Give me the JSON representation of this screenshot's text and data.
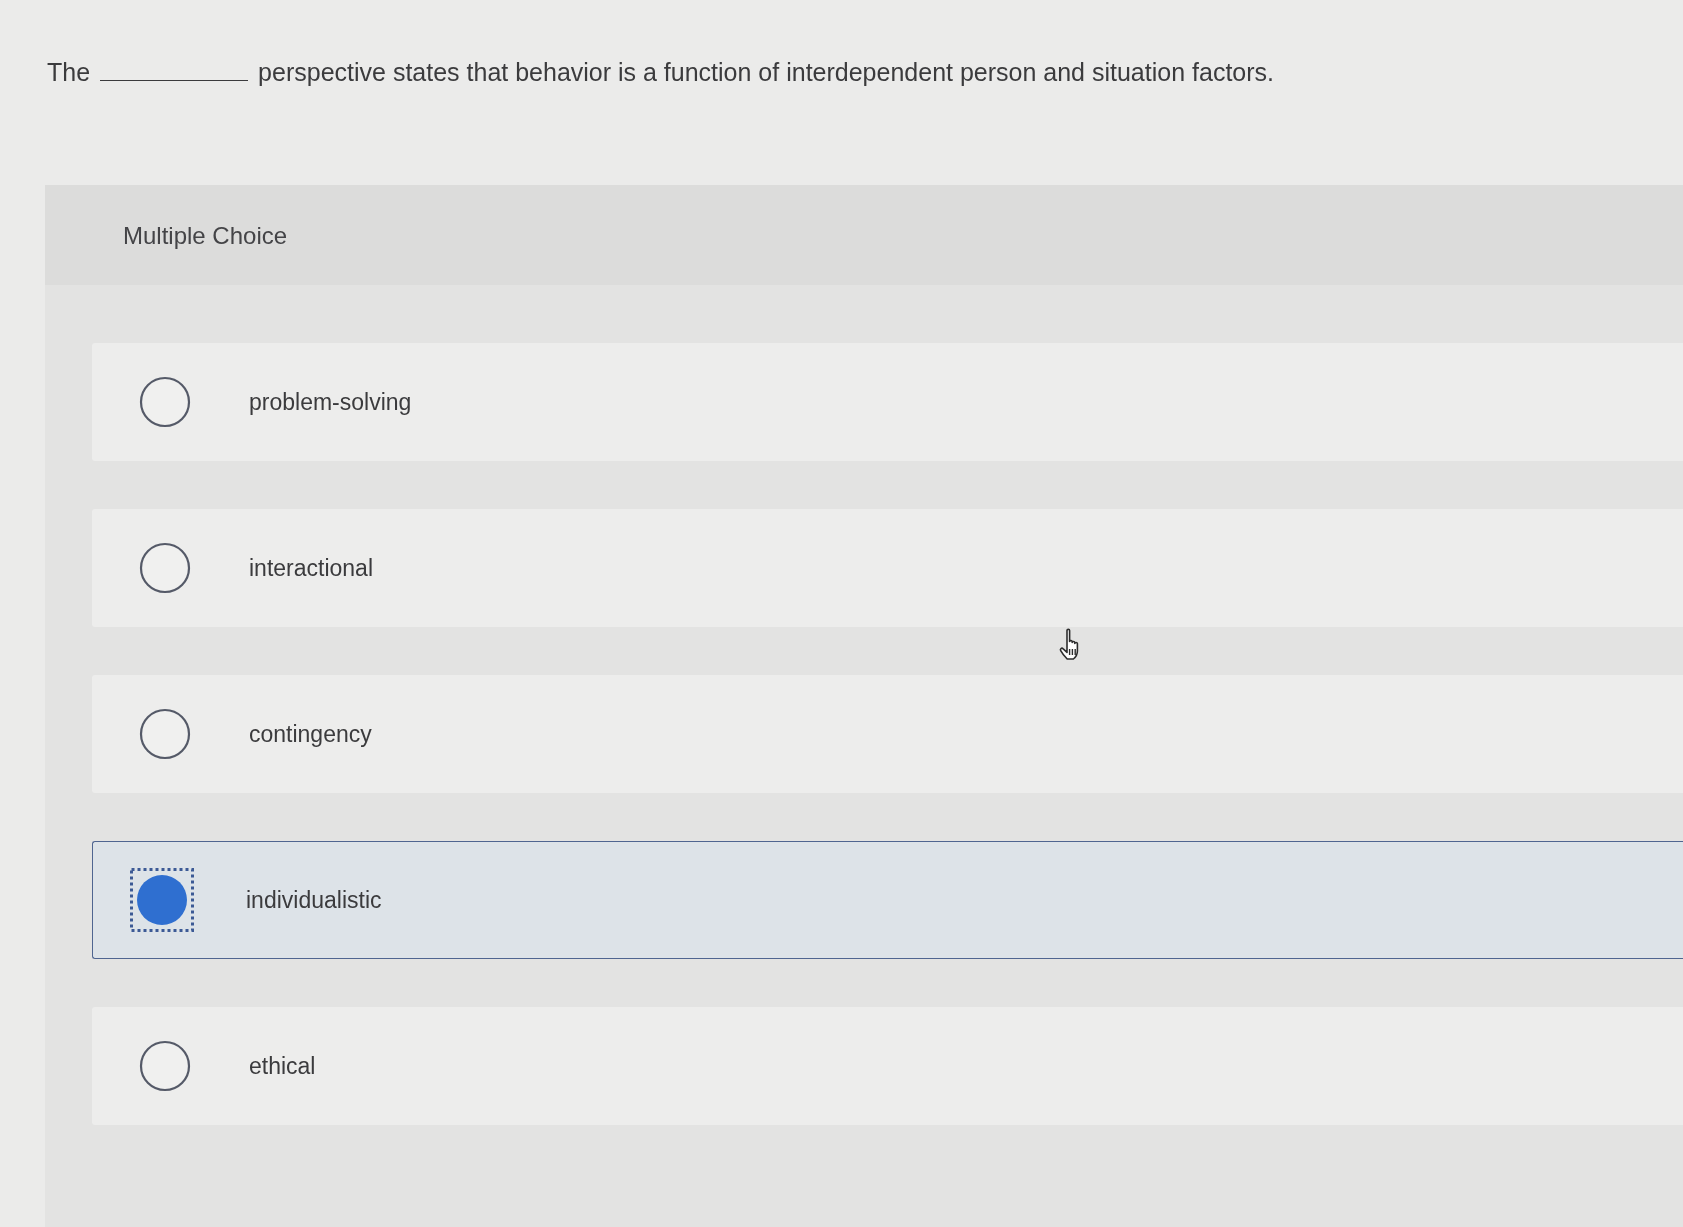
{
  "question": {
    "before": "The",
    "after": "perspective states that behavior is a function of interdependent person and situation factors."
  },
  "panel": {
    "heading": "Multiple Choice"
  },
  "choices": [
    {
      "label": "problem-solving",
      "selected": false
    },
    {
      "label": "interactional",
      "selected": false
    },
    {
      "label": "contingency",
      "selected": false
    },
    {
      "label": "individualistic",
      "selected": true
    },
    {
      "label": "ethical",
      "selected": false
    }
  ]
}
